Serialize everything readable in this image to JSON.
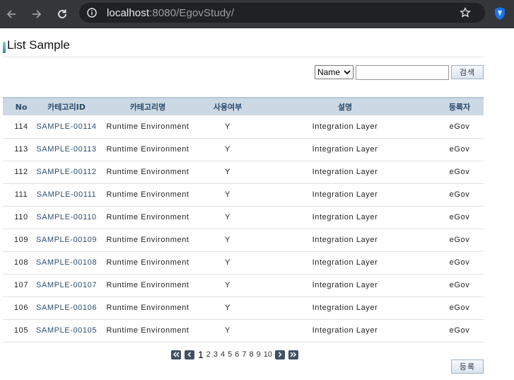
{
  "browser": {
    "url_host": "localhost",
    "url_rest": ":8080/EgovStudy/"
  },
  "page": {
    "title": "List Sample"
  },
  "search": {
    "select_value": "Name",
    "input_value": "",
    "button_label": "검색"
  },
  "table": {
    "headers": [
      "No",
      "카테고리ID",
      "카테고리명",
      "사용여부",
      "설명",
      "등록자"
    ],
    "rows": [
      [
        "114",
        "SAMPLE-00114",
        "Runtime Environment",
        "Y",
        "Integration Layer",
        "eGov"
      ],
      [
        "113",
        "SAMPLE-00113",
        "Runtime Environment",
        "Y",
        "Integration Layer",
        "eGov"
      ],
      [
        "112",
        "SAMPLE-00112",
        "Runtime Environment",
        "Y",
        "Integration Layer",
        "eGov"
      ],
      [
        "111",
        "SAMPLE-00111",
        "Runtime Environment",
        "Y",
        "Integration Layer",
        "eGov"
      ],
      [
        "110",
        "SAMPLE-00110",
        "Runtime Environment",
        "Y",
        "Integration Layer",
        "eGov"
      ],
      [
        "109",
        "SAMPLE-00109",
        "Runtime Environment",
        "Y",
        "Integration Layer",
        "eGov"
      ],
      [
        "108",
        "SAMPLE-00108",
        "Runtime Environment",
        "Y",
        "Integration Layer",
        "eGov"
      ],
      [
        "107",
        "SAMPLE-00107",
        "Runtime Environment",
        "Y",
        "Integration Layer",
        "eGov"
      ],
      [
        "106",
        "SAMPLE-00106",
        "Runtime Environment",
        "Y",
        "Integration Layer",
        "eGov"
      ],
      [
        "105",
        "SAMPLE-00105",
        "Runtime Environment",
        "Y",
        "Integration Layer",
        "eGov"
      ]
    ]
  },
  "pagination": {
    "current": "1",
    "pages": [
      "2",
      "3",
      "4",
      "5",
      "6",
      "7",
      "8",
      "9",
      "10"
    ],
    "icons": [
      "first-page-icon",
      "prev-page-icon",
      "next-page-icon",
      "last-page-icon"
    ]
  },
  "actions": {
    "register_label": "등록"
  },
  "colors": {
    "header_bg": "#ccd9e4",
    "header_text": "#2b4a6b",
    "link_text": "#2d4e6e",
    "pager_button": "#3f5163"
  }
}
